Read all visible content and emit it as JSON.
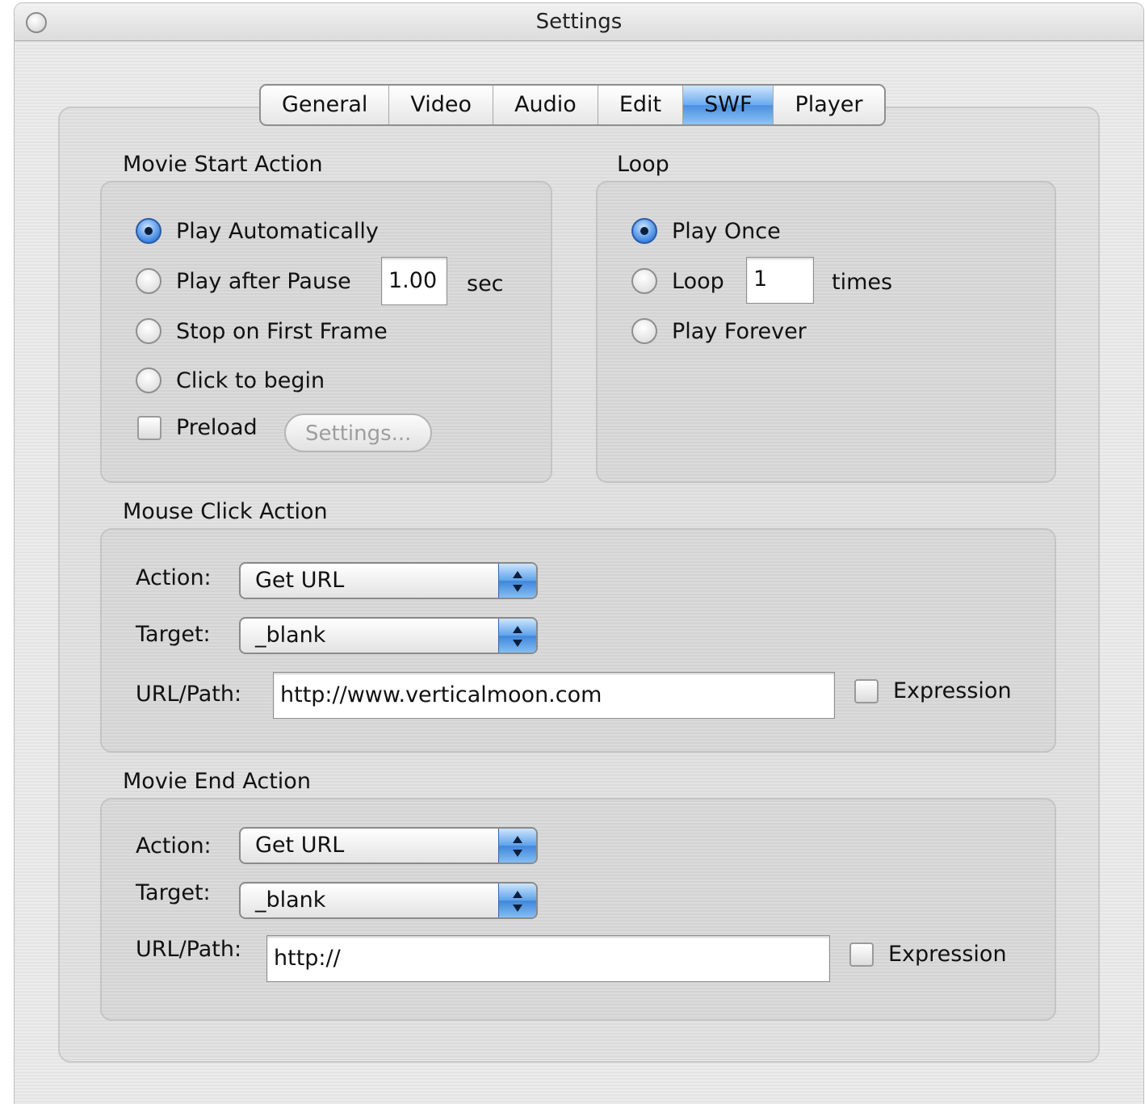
{
  "window": {
    "title": "Settings"
  },
  "tabs": [
    {
      "label": "General",
      "active": false
    },
    {
      "label": "Video",
      "active": false
    },
    {
      "label": "Audio",
      "active": false
    },
    {
      "label": "Edit",
      "active": false
    },
    {
      "label": "SWF",
      "active": true
    },
    {
      "label": "Player",
      "active": false
    }
  ],
  "movie_start": {
    "title": "Movie Start Action",
    "options": [
      {
        "label": "Play Automatically",
        "selected": true
      },
      {
        "label": "Play after Pause",
        "selected": false
      },
      {
        "label": "Stop on First Frame",
        "selected": false
      },
      {
        "label": "Click to begin",
        "selected": false
      }
    ],
    "pause_value": "1.00",
    "pause_unit": "sec",
    "preload_label": "Preload",
    "preload_checked": false,
    "settings_button": "Settings..."
  },
  "loop": {
    "title": "Loop",
    "options": [
      {
        "label": "Play Once",
        "selected": true
      },
      {
        "label": "Loop",
        "selected": false
      },
      {
        "label": "Play Forever",
        "selected": false
      }
    ],
    "loop_count": "1",
    "loop_unit": "times"
  },
  "mouse_click": {
    "title": "Mouse Click Action",
    "action_label": "Action:",
    "action_value": "Get URL",
    "target_label": "Target:",
    "target_value": "_blank",
    "url_label": "URL/Path:",
    "url_value": "http://www.verticalmoon.com",
    "expression_label": "Expression",
    "expression_checked": false
  },
  "movie_end": {
    "title": "Movie End Action",
    "action_label": "Action:",
    "action_value": "Get URL",
    "target_label": "Target:",
    "target_value": "_blank",
    "url_label": "URL/Path:",
    "url_value": "http://",
    "expression_label": "Expression",
    "expression_checked": false
  },
  "colors": {
    "accent": "#4a8fe0",
    "window_bg": "#ececec",
    "group_border": "#c4c4c4"
  }
}
